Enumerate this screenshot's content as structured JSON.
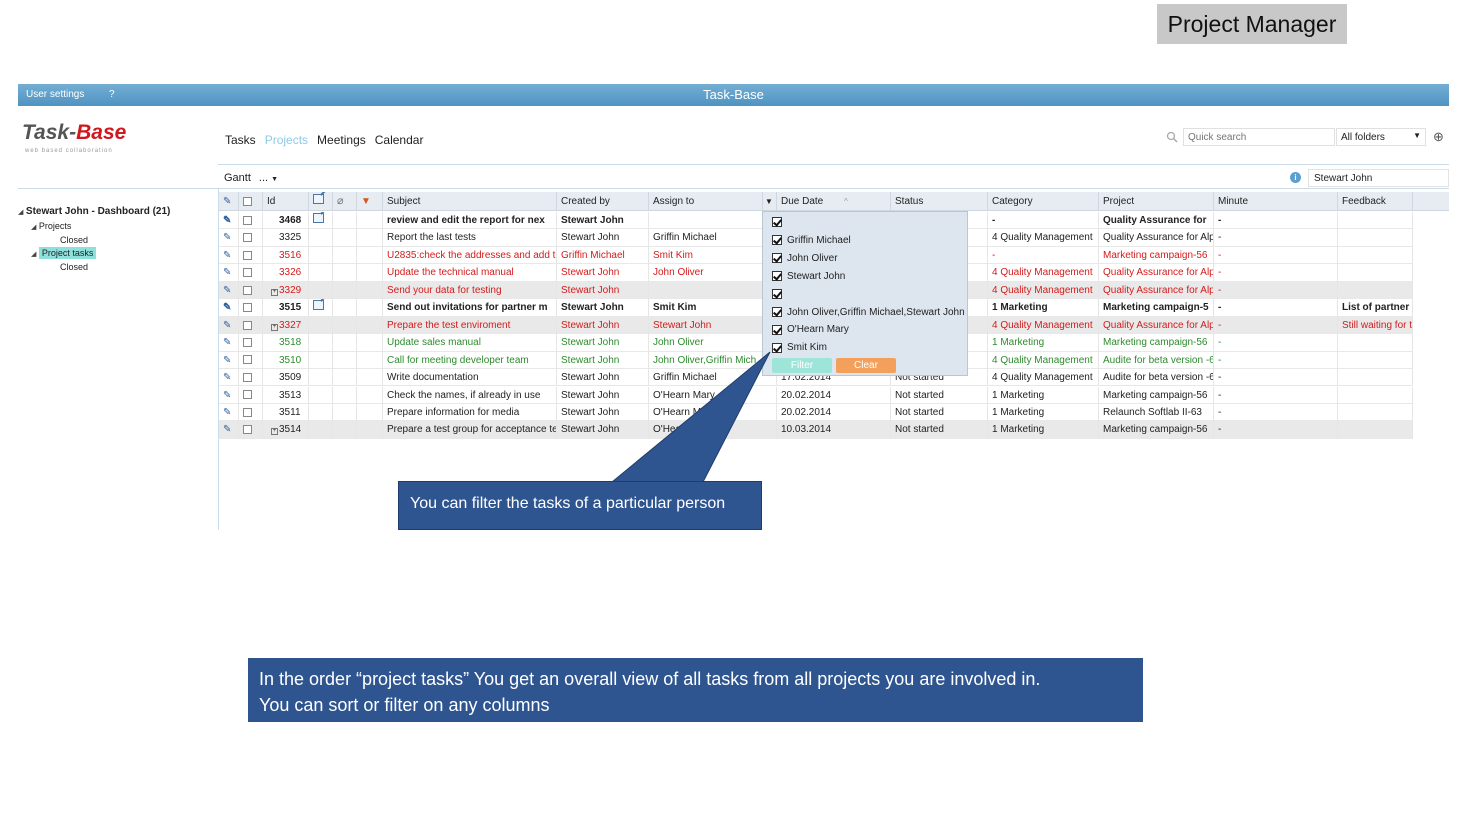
{
  "badge": "Project Manager",
  "topbar": {
    "user_settings": "User settings",
    "help": "?",
    "title": "Task-Base"
  },
  "logo": {
    "part1": "Task-",
    "part2": "Base",
    "tagline": "web based collaboration"
  },
  "nav": [
    "Tasks",
    "Projects",
    "Meetings",
    "Calendar"
  ],
  "search": {
    "placeholder": "Quick search",
    "folders": "All folders"
  },
  "toolbar": {
    "gantt": "Gantt",
    "more": "...",
    "user_filter": "Stewart John"
  },
  "tree": {
    "root": "Stewart John - Dashboard (21)",
    "projects": "Projects",
    "projects_closed": "Closed",
    "project_tasks": "Project tasks",
    "tasks_closed": "Closed"
  },
  "columns": [
    "Id",
    "Subject",
    "Created by",
    "Assign to",
    "Due Date",
    "Status",
    "Category",
    "Project",
    "Minute",
    "Feedback"
  ],
  "rows": [
    {
      "id": "3468",
      "subject": "review and edit the report for nex",
      "created": "Stewart John",
      "assign": "",
      "due": "",
      "status": "",
      "category": "-",
      "project": "Quality Assurance for",
      "minute": "-",
      "feedback": "",
      "style": "bold",
      "note": true,
      "expand": false
    },
    {
      "id": "3325",
      "subject": "Report the last tests",
      "created": "Stewart John",
      "assign": "Griffin Michael",
      "due": "",
      "status": "",
      "category": "4 Quality Management",
      "project": "Quality Assurance for Alp",
      "minute": "-",
      "feedback": "",
      "style": "",
      "note": false,
      "expand": false
    },
    {
      "id": "3516",
      "subject": "U2835:check the addresses and add th",
      "created": "Griffin Michael",
      "assign": "Smit Kim",
      "due": "",
      "status": "",
      "category": "-",
      "project": "Marketing campaign-56",
      "minute": "-",
      "feedback": "",
      "style": "red",
      "note": false,
      "expand": false
    },
    {
      "id": "3326",
      "subject": "Update the technical manual",
      "created": "Stewart John",
      "assign": "John Oliver",
      "due": "",
      "status": "",
      "category": "4 Quality Management",
      "project": "Quality Assurance for Alp",
      "minute": "-",
      "feedback": "",
      "style": "red",
      "note": false,
      "expand": false
    },
    {
      "id": "3329",
      "subject": "Send your data for testing",
      "created": "Stewart John",
      "assign": "",
      "due": "",
      "status": "",
      "category": "4 Quality Management",
      "project": "Quality Assurance for Alp",
      "minute": "-",
      "feedback": "",
      "style": "red gray",
      "note": false,
      "expand": true
    },
    {
      "id": "3515",
      "subject": "Send out invitations for partner m",
      "created": "Stewart John",
      "assign": "Smit Kim",
      "due": "",
      "status": "",
      "category": "1 Marketing",
      "project": "Marketing campaign-5",
      "minute": "-",
      "feedback": "List of partner",
      "style": "bold",
      "note": true,
      "expand": false
    },
    {
      "id": "3327",
      "subject": "Prepare the test enviroment",
      "created": "Stewart John",
      "assign": "Stewart John",
      "due": "",
      "status": "",
      "category": "4 Quality Management",
      "project": "Quality Assurance for Alp",
      "minute": "-",
      "feedback": "Still waiting for t",
      "style": "red gray",
      "note": false,
      "expand": true
    },
    {
      "id": "3518",
      "subject": "Update sales manual",
      "created": "Stewart John",
      "assign": "John Oliver",
      "due": "",
      "status": "",
      "category": "1 Marketing",
      "project": "Marketing campaign-56",
      "minute": "-",
      "feedback": "",
      "style": "green",
      "note": false,
      "expand": false
    },
    {
      "id": "3510",
      "subject": "Call for meeting developer team",
      "created": "Stewart John",
      "assign": "John Oliver,Griffin Mich",
      "due": "",
      "status": "",
      "category": "4 Quality Management",
      "project": "Audite for beta version -6",
      "minute": "-",
      "feedback": "",
      "style": "green",
      "note": false,
      "expand": false
    },
    {
      "id": "3509",
      "subject": "Write documentation",
      "created": "Stewart John",
      "assign": "Griffin Michael",
      "due": "17.02.2014",
      "status": "Not started",
      "category": "4 Quality Management",
      "project": "Audite for beta version -6",
      "minute": "-",
      "feedback": "",
      "style": "",
      "note": false,
      "expand": false
    },
    {
      "id": "3513",
      "subject": "Check the names, if already in use",
      "created": "Stewart John",
      "assign": "O'Hearn Mary",
      "due": "20.02.2014",
      "status": "Not started",
      "category": "1 Marketing",
      "project": "Marketing campaign-56",
      "minute": "-",
      "feedback": "",
      "style": "",
      "note": false,
      "expand": false
    },
    {
      "id": "3511",
      "subject": "Prepare information for media",
      "created": "Stewart John",
      "assign": "O'Hearn Mary",
      "due": "20.02.2014",
      "status": "Not started",
      "category": "1 Marketing",
      "project": "Relaunch Softlab II-63",
      "minute": "-",
      "feedback": "",
      "style": "",
      "note": false,
      "expand": false
    },
    {
      "id": "3514",
      "subject": "Prepare a test group for acceptance te",
      "created": "Stewart John",
      "assign": "O'Hearn Mary",
      "due": "10.03.2014",
      "status": "Not started",
      "category": "1 Marketing",
      "project": "Marketing campaign-56",
      "minute": "-",
      "feedback": "",
      "style": "gray",
      "note": false,
      "expand": true
    }
  ],
  "filter": {
    "options": [
      "",
      "Griffin Michael",
      "John Oliver",
      "Stewart John",
      "",
      "John Oliver,Griffin Michael,Stewart John",
      "O'Hearn Mary",
      "Smit Kim"
    ],
    "filter_label": "Filter",
    "clear_label": "Clear"
  },
  "callouts": {
    "filter_tip": "You can filter the tasks of a particular person",
    "overview_line1": "In the order “project tasks” You get an overall view of all tasks from all projects you are involved in.",
    "overview_line2": "You can sort or filter on any columns"
  },
  "colors": {
    "topbar": "#5b9dc9",
    "callout": "#2f5590",
    "accent": "#8ec9e8",
    "red": "#d41b1b",
    "green": "#2e8b2e",
    "logo_red": "#d0181e",
    "clear_button": "#f2a05c",
    "filter_button": "#9ee5d9"
  }
}
